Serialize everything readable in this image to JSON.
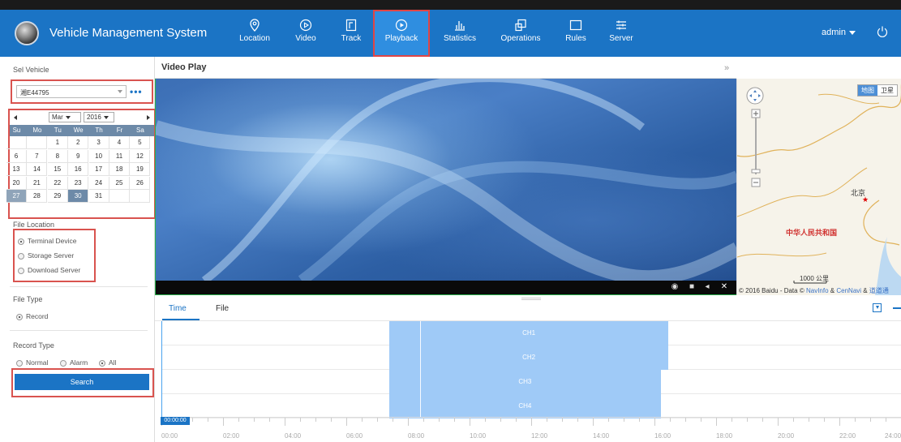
{
  "app": {
    "title": "Vehicle Management System"
  },
  "nav": [
    {
      "label": "Location",
      "icon": "location-pin-icon"
    },
    {
      "label": "Video",
      "icon": "play-circle-icon"
    },
    {
      "label": "Track",
      "icon": "track-icon"
    },
    {
      "label": "Playback",
      "icon": "playback-icon",
      "active": true
    },
    {
      "label": "Statistics",
      "icon": "bar-chart-icon"
    },
    {
      "label": "Operations",
      "icon": "operations-icon"
    },
    {
      "label": "Rules",
      "icon": "rules-icon"
    },
    {
      "label": "Server",
      "icon": "server-icon"
    }
  ],
  "user": {
    "name": "admin"
  },
  "left": {
    "sel_vehicle_label": "Sel Vehicle",
    "vehicle_value": "湘E44795",
    "more": "•••",
    "calendar": {
      "month": "Mar",
      "year": "2016",
      "dow": [
        "Su",
        "Mo",
        "Tu",
        "We",
        "Th",
        "Fr",
        "Sa"
      ],
      "weeks": [
        [
          "",
          "",
          "1",
          "2",
          "3",
          "4",
          "5"
        ],
        [
          "6",
          "7",
          "8",
          "9",
          "10",
          "11",
          "12"
        ],
        [
          "13",
          "14",
          "15",
          "16",
          "17",
          "18",
          "19"
        ],
        [
          "20",
          "21",
          "22",
          "23",
          "24",
          "25",
          "26"
        ],
        [
          "27",
          "28",
          "29",
          "30",
          "31",
          "",
          ""
        ]
      ],
      "selected_day": "30",
      "highlighted_day": "27"
    },
    "file_location_label": "File Location",
    "file_locations": [
      "Terminal Device",
      "Storage Server",
      "Download Server"
    ],
    "file_location_selected": "Terminal Device",
    "file_type_label": "File Type",
    "file_type_option": "Record",
    "record_type_label": "Record Type",
    "record_types": [
      "Normal",
      "Alarm",
      "All"
    ],
    "record_type_selected": "All",
    "search_label": "Search"
  },
  "video": {
    "title": "Video Play",
    "collapse": "»"
  },
  "map": {
    "tabs": [
      "地图",
      "卫星"
    ],
    "active_tab": "地图",
    "city_label": "北京",
    "country_label": "中华人民共和国",
    "scale_label": "1000 公里",
    "credit_text": "© 2016 Baidu - Data ©",
    "credit_links": [
      "NavInfo",
      "CenNavi",
      "道道通"
    ],
    "credit_amp": "&"
  },
  "tabs": [
    {
      "label": "Time",
      "active": true
    },
    {
      "label": "File"
    }
  ],
  "timeline": {
    "channels": [
      {
        "label": "CH1",
        "start_hour": 7.4,
        "end_hour": 16.45
      },
      {
        "label": "CH2",
        "start_hour": 7.4,
        "end_hour": 16.45
      },
      {
        "label": "CH3",
        "start_hour": 7.4,
        "end_hour": 16.2
      },
      {
        "label": "CH4",
        "start_hour": 7.4,
        "end_hour": 16.2
      }
    ],
    "cursor_hour": 8.4,
    "start_badge": "00:00:00",
    "ticks": [
      "00:00",
      "02:00",
      "04:00",
      "06:00",
      "08:00",
      "10:00",
      "12:00",
      "14:00",
      "16:00",
      "18:00",
      "20:00",
      "22:00",
      "24:00"
    ]
  }
}
